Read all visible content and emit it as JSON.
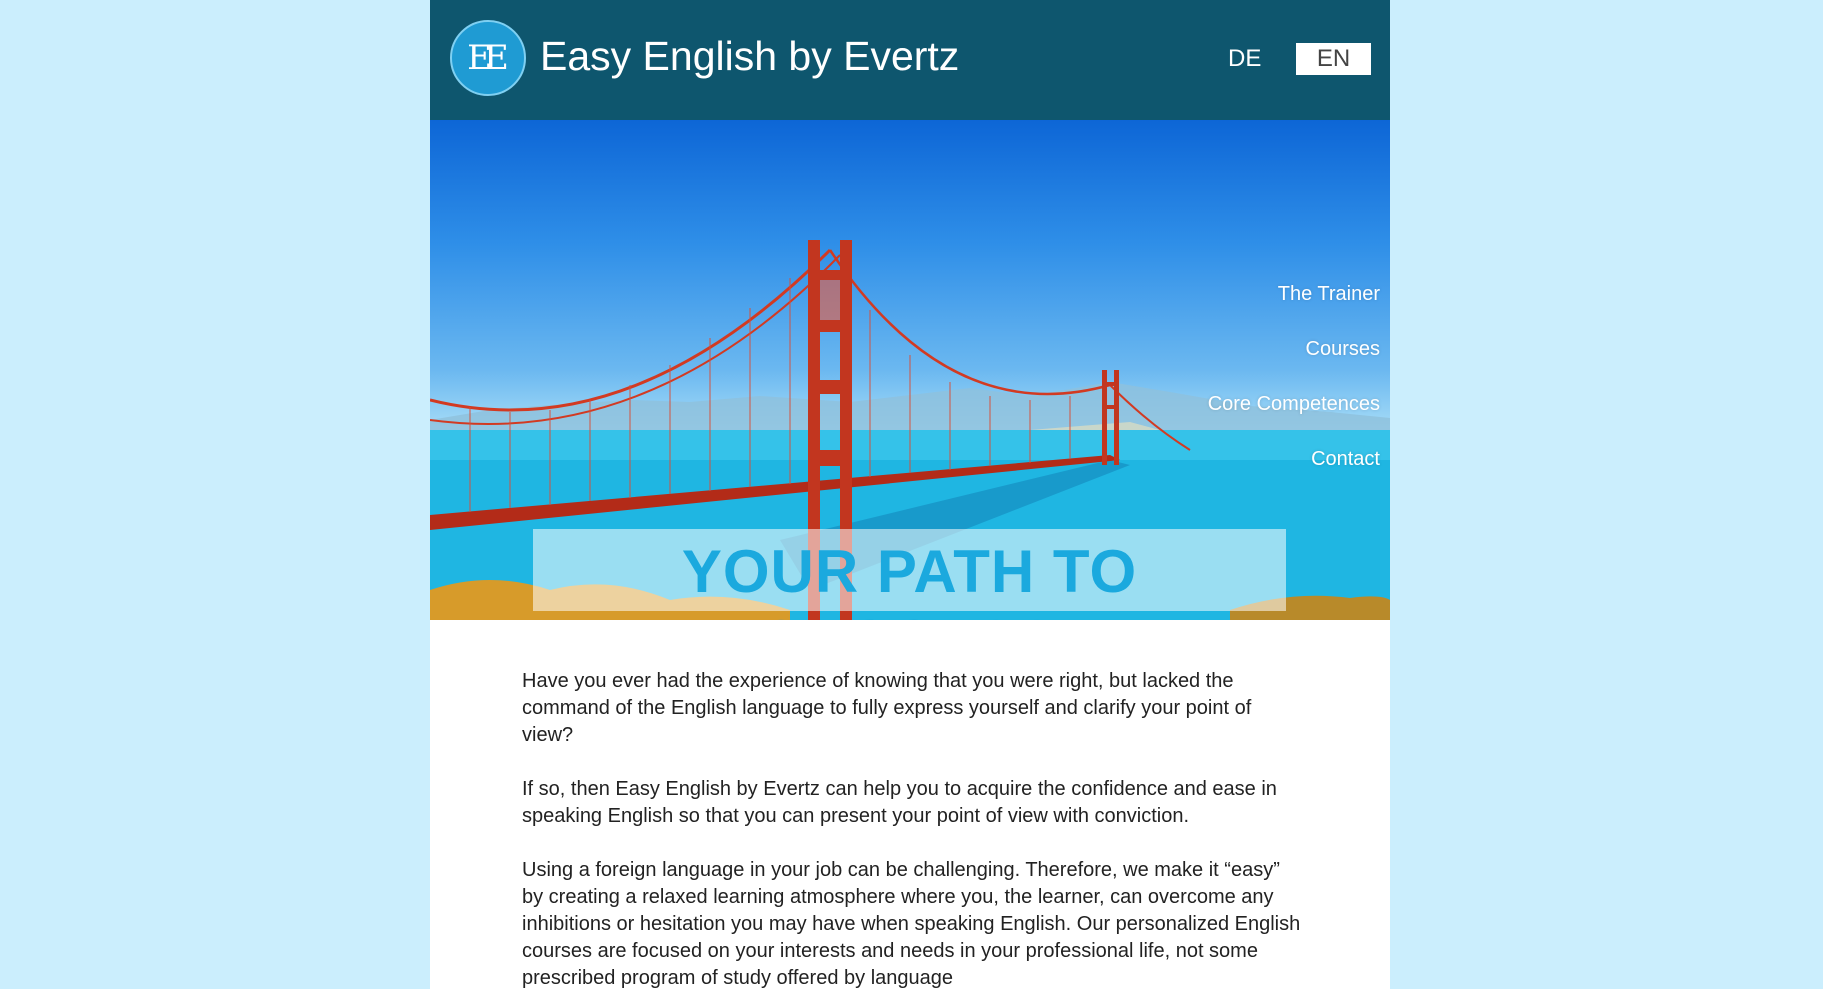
{
  "header": {
    "logo_letters": "EE",
    "title": "Easy English by Evertz",
    "lang_de": "DE",
    "lang_en": "EN"
  },
  "nav": {
    "items": [
      {
        "label": "The Trainer"
      },
      {
        "label": "Courses"
      },
      {
        "label": "Core Competences"
      },
      {
        "label": "Contact"
      }
    ]
  },
  "hero": {
    "slogan": "YOUR PATH TO SUCCESS"
  },
  "content": {
    "paragraphs": [
      "Have you ever had the experience of knowing that you were right, but lacked the command of the English language to fully express yourself and clarify your point of view?",
      "If so, then Easy English by Evertz can help you to acquire the confidence and ease in speaking English so that you can present your point of view with conviction.",
      "Using a foreign language in your job can be challenging. Therefore, we make it “easy” by creating a relaxed learning atmosphere where you, the learner, can overcome any inhibitions or hesitation you may have when speaking English. Our personalized English courses are focused on your interests and needs in your professional life, not some prescribed program of study offered by language"
    ]
  },
  "colors": {
    "background": "#cbeefd",
    "header": "#0e566e",
    "accent": "#1ba9de",
    "bridge": "#c8321e"
  }
}
